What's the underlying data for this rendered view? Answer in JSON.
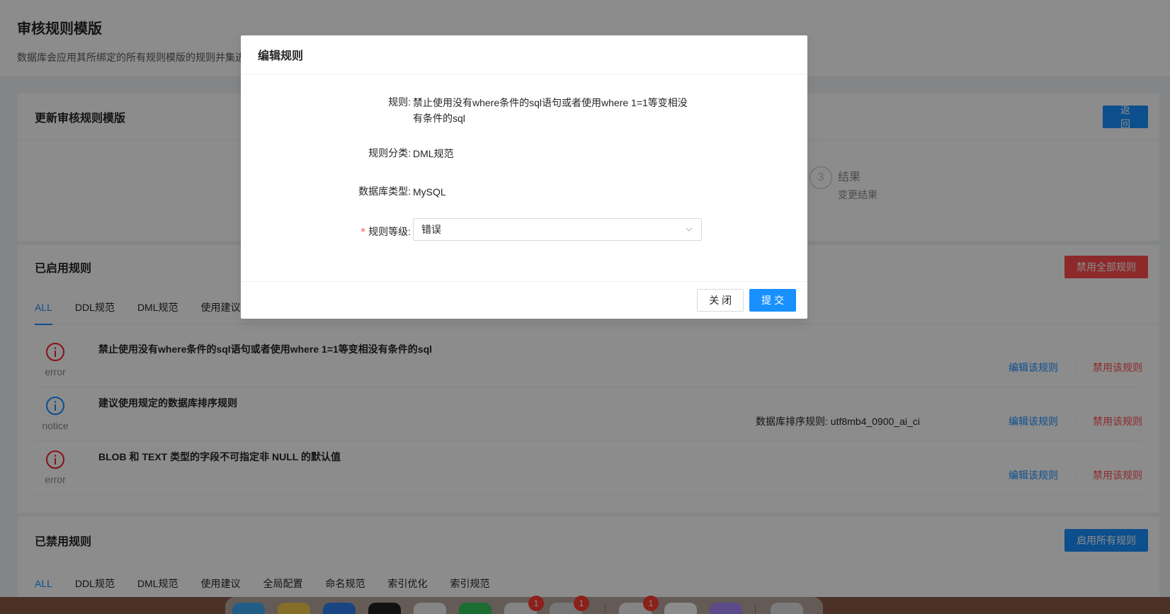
{
  "page": {
    "title": "审核规则模版",
    "description": "数据库会应用其所绑定的所有规则模版的规则并集进行审核"
  },
  "update_card": {
    "title": "更新审核规则模版",
    "return_label": "返 回",
    "step3": {
      "number": "3",
      "title": "结果",
      "desc": "变更结果"
    }
  },
  "enabled": {
    "title": "已启用规则",
    "disable_all_label": "禁用全部规则",
    "tabs": [
      "ALL",
      "DDL规范",
      "DML规范",
      "使用建议"
    ],
    "rules": [
      {
        "level": "error",
        "name": "禁止使用没有where条件的sql语句或者使用where 1=1等变相没有条件的sql",
        "param": "",
        "edit": "编辑该规则",
        "disable": "禁用该规则"
      },
      {
        "level": "notice",
        "name": "建议使用规定的数据库排序规则",
        "param": "数据库排序规则: utf8mb4_0900_ai_ci",
        "edit": "编辑该规则",
        "disable": "禁用该规则"
      },
      {
        "level": "error",
        "name": "BLOB 和 TEXT 类型的字段不可指定非 NULL 的默认值",
        "param": "",
        "edit": "编辑该规则",
        "disable": "禁用该规则"
      }
    ],
    "colors": {
      "error": "#f5222d",
      "notice": "#1890ff"
    }
  },
  "disabled": {
    "title": "已禁用规则",
    "enable_all_label": "启用所有规则",
    "tabs": [
      "ALL",
      "DDL规范",
      "DML规范",
      "使用建议",
      "全局配置",
      "命名规范",
      "索引优化",
      "索引规范"
    ]
  },
  "modal": {
    "title": "编辑规则",
    "rule_label": "规则:",
    "rule_value_line1": "禁止使用没有where条件的sql语句或者使用where 1=1等变相没",
    "rule_value_line2": "有条件的sql",
    "category_label": "规则分类:",
    "category_value": "DML规范",
    "db_type_label": "数据库类型:",
    "db_type_value": "MySQL",
    "level_required_mark": "*",
    "level_label": "规则等级:",
    "level_value": "错误",
    "close_label": "关 闭",
    "submit_label": "提 交"
  },
  "dock": {
    "badges": [
      "1",
      "1",
      "1"
    ]
  }
}
